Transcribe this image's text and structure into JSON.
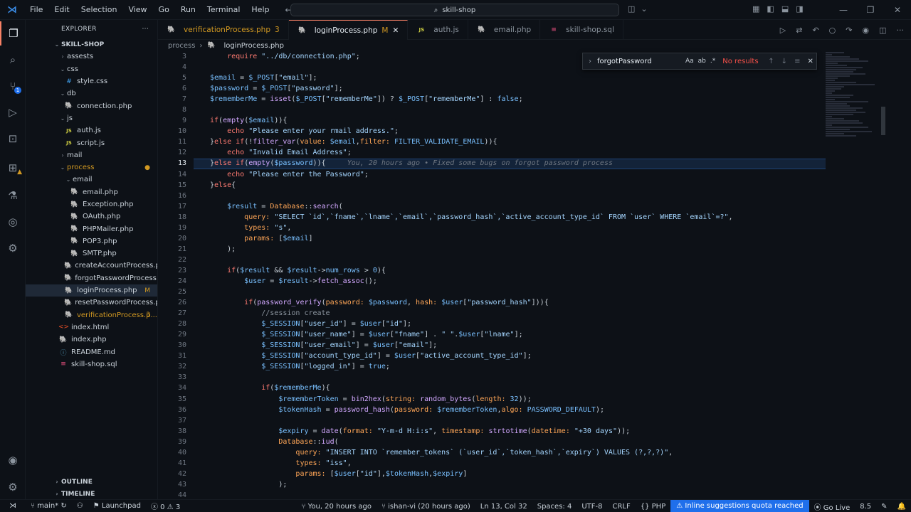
{
  "menu": [
    "File",
    "Edit",
    "Selection",
    "View",
    "Go",
    "Run",
    "Terminal",
    "Help"
  ],
  "search": {
    "text": "skill-shop"
  },
  "explorer": {
    "header": "EXPLORER",
    "project": "SKILL-SHOP",
    "items": [
      {
        "label": "assests",
        "type": "folder",
        "depth": 1,
        "open": false
      },
      {
        "label": "css",
        "type": "folder",
        "depth": 1,
        "open": true
      },
      {
        "label": "style.css",
        "type": "css",
        "depth": 2
      },
      {
        "label": "db",
        "type": "folder",
        "depth": 1,
        "open": true
      },
      {
        "label": "connection.php",
        "type": "php",
        "depth": 2
      },
      {
        "label": "js",
        "type": "folder",
        "depth": 1,
        "open": true
      },
      {
        "label": "auth.js",
        "type": "js",
        "depth": 2
      },
      {
        "label": "script.js",
        "type": "js",
        "depth": 2
      },
      {
        "label": "mail",
        "type": "folder",
        "depth": 1,
        "open": false
      },
      {
        "label": "process",
        "type": "folder",
        "depth": 1,
        "open": true,
        "warn": true
      },
      {
        "label": "email",
        "type": "folder",
        "depth": 2,
        "open": true
      },
      {
        "label": "email.php",
        "type": "php",
        "depth": 3
      },
      {
        "label": "Exception.php",
        "type": "php",
        "depth": 3
      },
      {
        "label": "OAuth.php",
        "type": "php",
        "depth": 3
      },
      {
        "label": "PHPMailer.php",
        "type": "php",
        "depth": 3
      },
      {
        "label": "POP3.php",
        "type": "php",
        "depth": 3
      },
      {
        "label": "SMTP.php",
        "type": "php",
        "depth": 3
      },
      {
        "label": "createAccountProcess.php",
        "type": "php",
        "depth": 2
      },
      {
        "label": "forgotPasswordProcess.p...",
        "type": "php",
        "depth": 2
      },
      {
        "label": "loginProcess.php",
        "type": "php",
        "depth": 2,
        "selected": true,
        "status": "M"
      },
      {
        "label": "resetPasswordProcess.php",
        "type": "php",
        "depth": 2
      },
      {
        "label": "verificationProcess.p...",
        "type": "php",
        "depth": 2,
        "status": "3",
        "warn": true
      },
      {
        "label": "index.html",
        "type": "html",
        "depth": 1
      },
      {
        "label": "index.php",
        "type": "php",
        "depth": 1
      },
      {
        "label": "README.md",
        "type": "md",
        "depth": 1
      },
      {
        "label": "skill-shop.sql",
        "type": "sql",
        "depth": 1
      }
    ],
    "outline": "OUTLINE",
    "timeline": "TIMELINE"
  },
  "tabs": [
    {
      "label": "verificationProcess.php",
      "badge": "3",
      "type": "php"
    },
    {
      "label": "loginProcess.php",
      "badge": "M",
      "type": "php",
      "active": true
    },
    {
      "label": "auth.js",
      "badge": "",
      "type": "js"
    },
    {
      "label": "email.php",
      "badge": "",
      "type": "php"
    },
    {
      "label": "skill-shop.sql",
      "badge": "",
      "type": "sql"
    }
  ],
  "breadcrumb": [
    "process",
    "loginProcess.php"
  ],
  "find": {
    "query": "forgotPassword",
    "result": "No results",
    "opt1": "Aa",
    "opt2": "ab",
    "opt3": ".*"
  },
  "editor": {
    "current_line": 13,
    "line_start": 3,
    "blame": "You, 20 hours ago • Fixed some bugs on forgot password process"
  },
  "status": {
    "branch": "main*",
    "launchpad": "Launchpad",
    "errors": "0",
    "warnings": "3",
    "blame": "You, 20 hours ago",
    "author": "ishan-vi (20 hours ago)",
    "position": "Ln 13, Col 32",
    "spaces": "Spaces: 4",
    "encoding": "UTF-8",
    "eol": "CRLF",
    "language": "PHP",
    "quota": "Inline suggestions quota reached",
    "golive": "Go Live",
    "version": "8.5"
  }
}
